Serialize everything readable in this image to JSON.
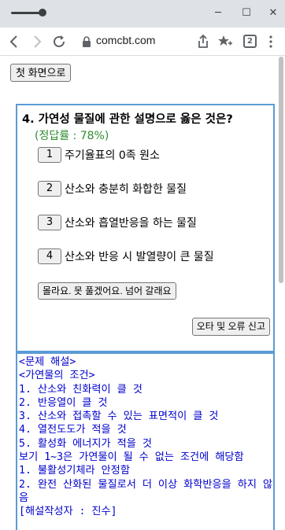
{
  "browser": {
    "url": "comcbt.com",
    "tab_count": "2",
    "window_controls": {
      "minimize": "─",
      "maximize": "☐",
      "close": "✕"
    },
    "icons": [
      "back-icon",
      "forward-icon",
      "reload-icon",
      "lock-icon",
      "share-icon",
      "bookmark-icon",
      "tab-count-icon",
      "menu-icon"
    ]
  },
  "page": {
    "home_button": "첫 화면으로",
    "question": {
      "title": "4. 가연성 물질에 관한 설명으로 옳은 것은?",
      "rate": "(정답률 : 78%)",
      "options": [
        {
          "num": "1",
          "text": "주기율표의 0족 원소"
        },
        {
          "num": "2",
          "text": "산소와 충분히 화합한 물질"
        },
        {
          "num": "3",
          "text": "산소와 흡열반응을 하는 물질"
        },
        {
          "num": "4",
          "text": "산소와 반응 시 발열량이 큰 물질"
        }
      ],
      "skip_button": "몰라요. 못 풀겠어요. 넘어 갈래요",
      "report_button": "오타 및 오류 신고"
    },
    "explanation": {
      "lines": [
        "<문제 해설>",
        "<가연물의 조건>",
        "1. 산소와 친화력이 클 것",
        "2. 반응열이 클 것",
        "3. 산소와 접촉할 수 있는 표면적이 클 것",
        "4. 열전도도가 적을 것",
        "5. 활성화 에너지가 적을 것",
        "보기 1~3은 가연물이 될 수 없는 조건에 해당함",
        "1. 불활성기체라 안정함",
        "2. 완전 산화된 물질로서 더 이상 화학반응을 하지 않음",
        "[해설작성자 : 진수]"
      ]
    }
  },
  "colors": {
    "box_border": "#5b9bd5",
    "rate_text": "#2e8b2e",
    "explanation_text": "#0000cc",
    "chrome_bg": "#dee1e6"
  }
}
